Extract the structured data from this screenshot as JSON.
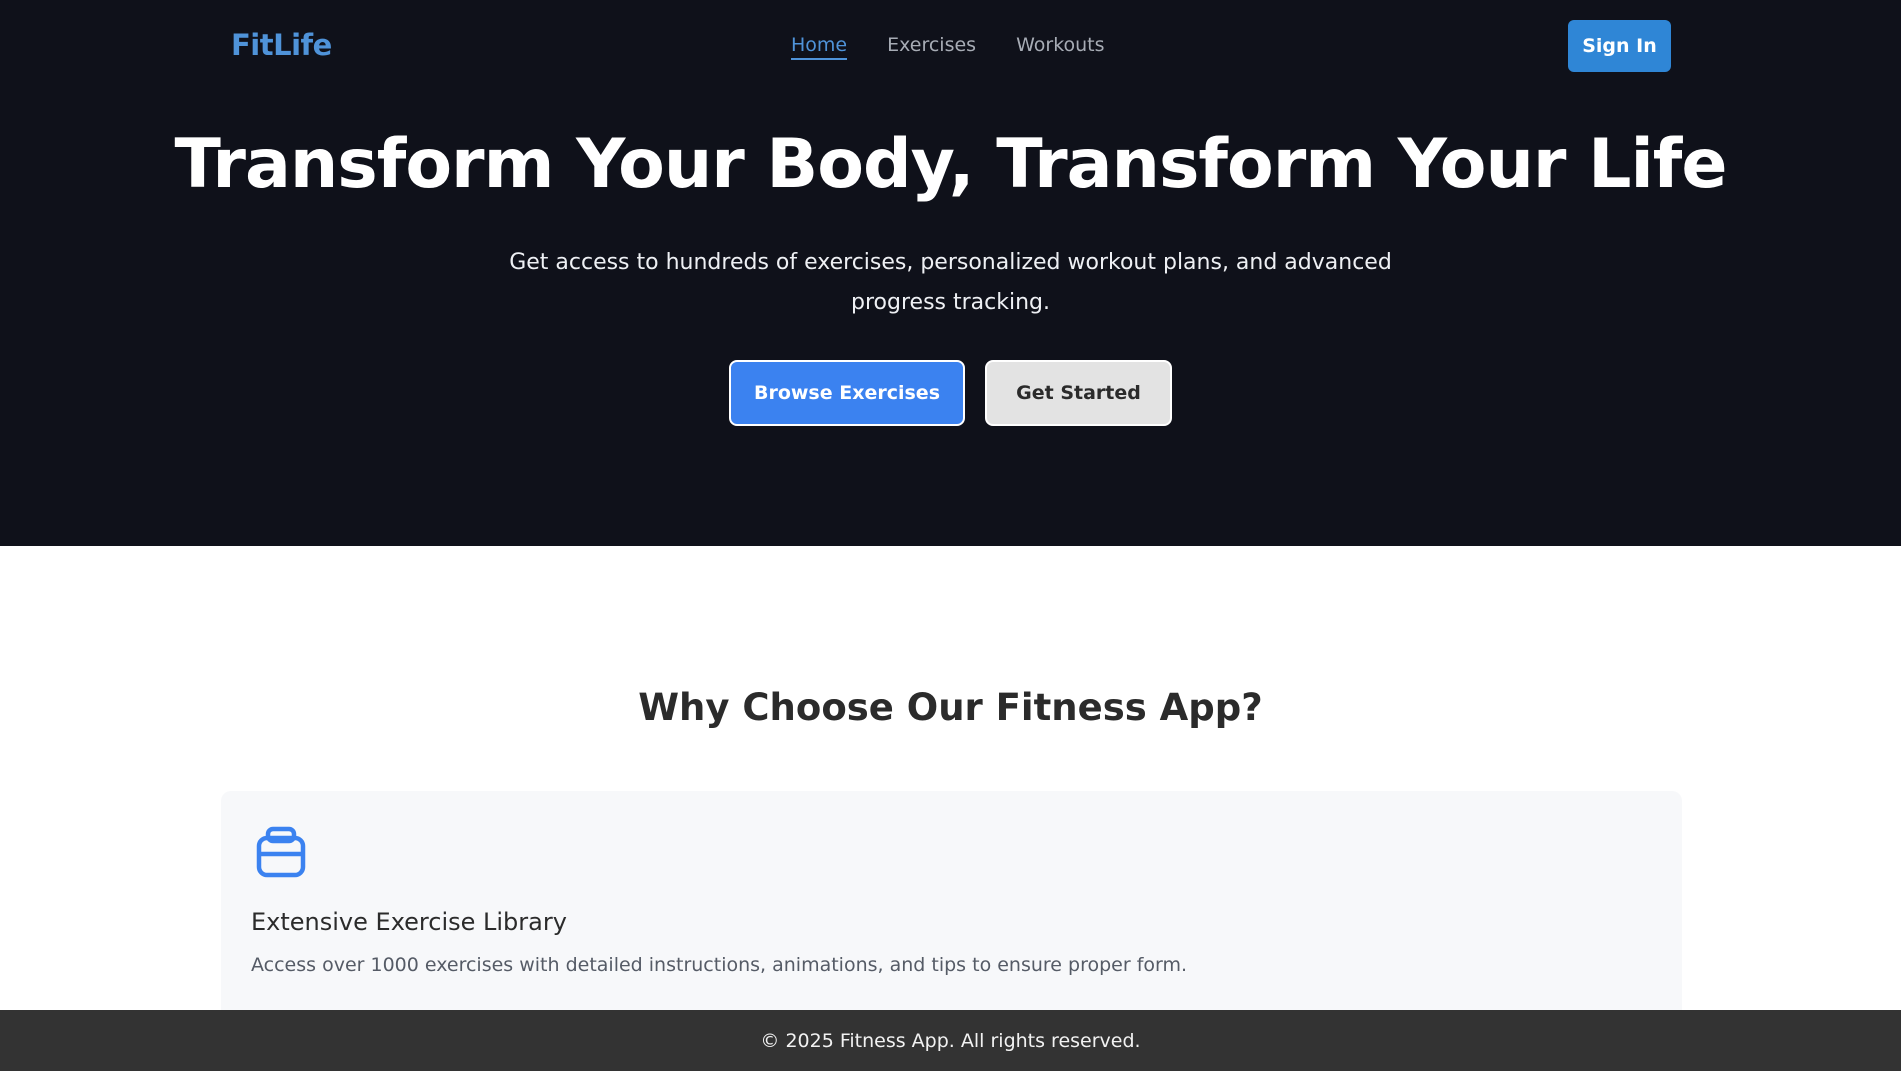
{
  "nav": {
    "logo": "FitLife",
    "links": [
      {
        "label": "Home",
        "active": true
      },
      {
        "label": "Exercises",
        "active": false
      },
      {
        "label": "Workouts",
        "active": false
      }
    ],
    "signin_label": "Sign In"
  },
  "hero": {
    "title": "Transform Your Body, Transform Your Life",
    "subtitle": "Get access to hundreds of exercises, personalized workout plans, and advanced progress tracking.",
    "primary_label": "Browse Exercises",
    "secondary_label": "Get Started"
  },
  "features": {
    "title": "Why Choose Our Fitness App?",
    "items": [
      {
        "icon": "weight-icon",
        "heading": "Extensive Exercise Library",
        "text": "Access over 1000 exercises with detailed instructions, animations, and tips to ensure proper form."
      }
    ]
  },
  "footer": {
    "text": "© 2025 Fitness App. All rights reserved."
  },
  "colors": {
    "hero_bg": "#0f111a",
    "accent": "#4f93d9",
    "signin_bg": "#2f86d6",
    "primary_btn": "#3b82f0",
    "footer_bg": "#333333"
  }
}
